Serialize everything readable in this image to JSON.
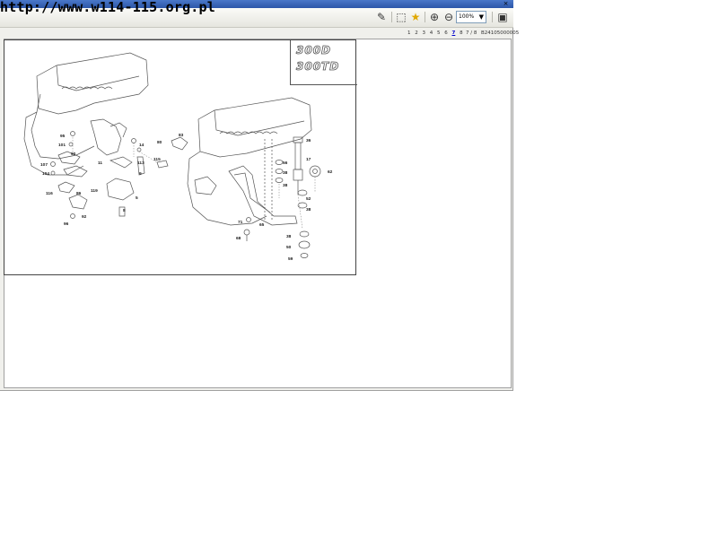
{
  "watermark": "http://www.w114-115.org.pl",
  "window": {
    "close_glyph": "×"
  },
  "toolbar": {
    "icons": [
      "edit-note-icon",
      "select-icon",
      "favorite-star-icon",
      "zoom-in-icon",
      "zoom-out-icon",
      "single-page-icon"
    ],
    "zoom_value": "100%"
  },
  "pager": {
    "pages": [
      "1",
      "2",
      "3",
      "4",
      "5",
      "6",
      "7",
      "8"
    ],
    "current": "7",
    "page_info": "7 / 8",
    "part_number": "B24105000005"
  },
  "drawing": {
    "badges": [
      "300D",
      "300TD"
    ],
    "callouts_left": [
      "95",
      "101",
      "107",
      "104",
      "116",
      "86",
      "92",
      "96",
      "80",
      "119",
      "11",
      "14",
      "113",
      "115",
      "9",
      "5",
      "8",
      "83",
      "90"
    ],
    "callouts_right": [
      "36",
      "17",
      "62",
      "56",
      "38",
      "38",
      "52",
      "38",
      "71",
      "68",
      "65",
      "38",
      "50",
      "59"
    ]
  }
}
